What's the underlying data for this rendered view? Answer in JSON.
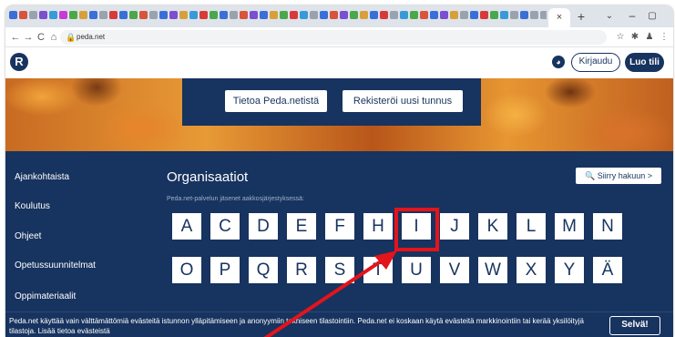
{
  "browser": {
    "active_tab_icon": "×",
    "new_tab_symbol": "+",
    "tab_menu_symbol": "⌄",
    "minimize_symbol": "–",
    "maximize_symbol": "▢",
    "back_symbol": "←",
    "forward_symbol": "→",
    "reload_symbol": "C",
    "home_symbol": "⌂",
    "lock_symbol": "🔒",
    "url": "peda.net",
    "toolbar_icons": [
      "☆",
      "✱",
      "♟",
      "⋮"
    ],
    "tab_icon_colors": [
      "#3a6fd8",
      "#d8543a",
      "#9aa3ad",
      "#7a4fd0",
      "#3a9ad8",
      "#c83ad8",
      "#4aa84a",
      "#d8a03a",
      "#3a6fd8",
      "#9aa3ad",
      "#d83a3a",
      "#3a6fd8",
      "#4aa84a",
      "#d8543a",
      "#9aa3ad",
      "#3a6fd8",
      "#7a4fd0",
      "#d8a03a",
      "#3a9ad8",
      "#d83a3a",
      "#4aa84a",
      "#3a6fd8",
      "#9aa3ad",
      "#d8543a",
      "#7a4fd0",
      "#3a6fd8",
      "#d8a03a",
      "#4aa84a",
      "#d83a3a",
      "#3a9ad8",
      "#9aa3ad",
      "#3a6fd8",
      "#d8543a",
      "#7a4fd0",
      "#4aa84a",
      "#d8a03a",
      "#3a6fd8",
      "#d83a3a",
      "#9aa3ad",
      "#3a9ad8",
      "#4aa84a",
      "#d8543a",
      "#3a6fd8",
      "#7a4fd0",
      "#d8a03a",
      "#9aa3ad",
      "#3a6fd8",
      "#d83a3a",
      "#4aa84a",
      "#3a9ad8",
      "#9aa3ad",
      "#3a6fd8",
      "#9aa3ad",
      "#9aa3ad",
      "#9aa3ad",
      "#9aa3ad",
      "#d8543a",
      "#3a6fd8",
      "#3a6fd8",
      "#3a6fd8"
    ]
  },
  "site": {
    "logo_letter": "R",
    "globe_symbol": "◕",
    "login_label": "Kirjaudu",
    "signup_label": "Luo tili"
  },
  "banner": {
    "about_label": "Tietoa Peda.netistä",
    "register_label": "Rekisteröi uusi tunnus"
  },
  "sidebar": {
    "items": [
      "Ajankohtaista",
      "Koulutus",
      "Ohjeet",
      "Opetussuunnitelmat",
      "Oppimateriaalit"
    ]
  },
  "main": {
    "title": "Organisaatiot",
    "search_label": "🔍 Siirry hakuun >",
    "subtitle": "Peda.net-palvelun jäsenet aakkosjärjestyksessä:",
    "row1": [
      "A",
      "C",
      "D",
      "E",
      "F",
      "H",
      "I",
      "J",
      "K",
      "L",
      "M",
      "N"
    ],
    "row2": [
      "O",
      "P",
      "Q",
      "R",
      "S",
      "T",
      "U",
      "V",
      "W",
      "X",
      "Y",
      "Ä"
    ],
    "highlighted_letter": "I",
    "highlight_color": "#e3141b",
    "brand_color": "#17335f"
  },
  "cookie": {
    "text": "Peda.net käyttää vain välttämättömiä evästeitä istunnon ylläpitämiseen ja anonyymiin tekniseen tilastointiin. Peda.net ei koskaan käytä evästeitä markkinointiin tai kerää yksilöityjä tilastoja. Lisää tietoa evästeistä",
    "accept_label": "Selvä!"
  }
}
